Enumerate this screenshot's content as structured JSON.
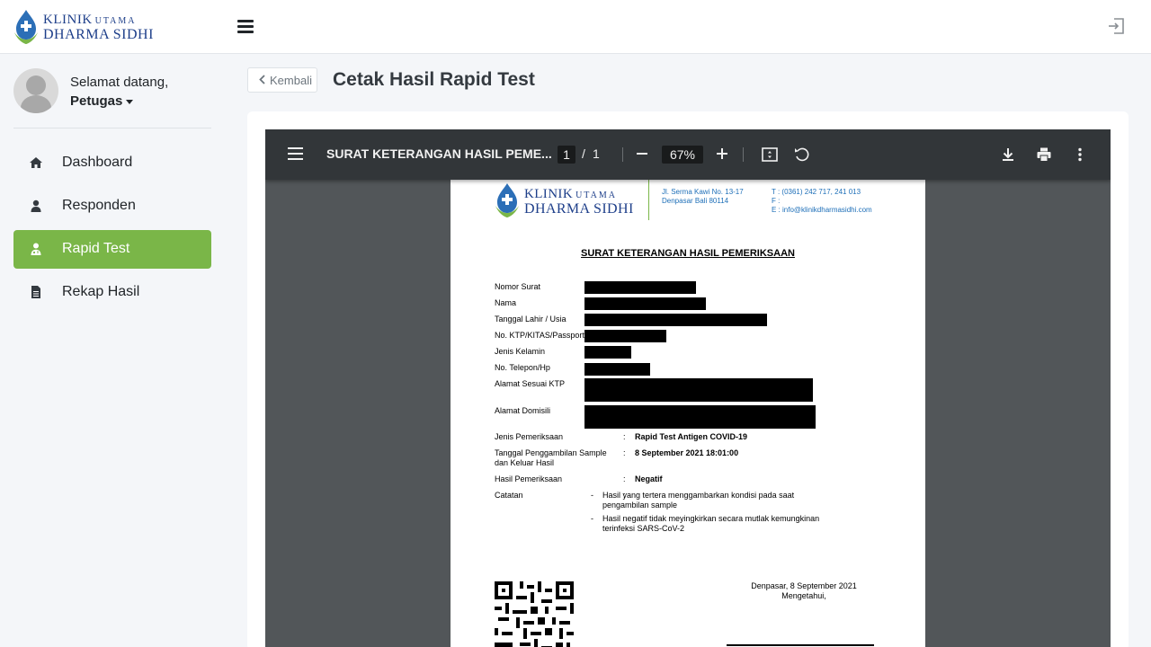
{
  "brand": {
    "line1": "KLINIK",
    "line1_small": "UTAMA",
    "line2": "DHARMA SIDHI"
  },
  "header": {
    "menu_icon": "hamburger-icon",
    "logout_icon": "sign-out-icon"
  },
  "user": {
    "greeting": "Selamat datang,",
    "name": "Petugas"
  },
  "sidebar": {
    "items": [
      {
        "label": "Dashboard",
        "icon": "home-icon",
        "active": false
      },
      {
        "label": "Responden",
        "icon": "user-icon",
        "active": false
      },
      {
        "label": "Rapid Test",
        "icon": "user-md-icon",
        "active": true
      },
      {
        "label": "Rekap Hasil",
        "icon": "file-text-icon",
        "active": false
      }
    ]
  },
  "main": {
    "back_label": "Kembali",
    "title": "Cetak Hasil Rapid Test"
  },
  "viewer": {
    "doc_title": "SURAT KETERANGAN HASIL PEME...",
    "page_current": "1",
    "page_separator": "/",
    "page_total": "1",
    "zoom": "67%"
  },
  "pdf": {
    "header": {
      "address_line1": "Jl. Serma Kawi No. 13-17",
      "address_line2": "Denpasar Bali 80114",
      "phone": "T : (0361) 242 717, 241 013",
      "fax": "F :",
      "email": "E : info@klinikdharmasidhi.com"
    },
    "heading": "SURAT KETERANGAN HASIL PEMERIKSAAN",
    "colon": ":",
    "fields": {
      "nomor_surat": "Nomor Surat",
      "nama": "Nama",
      "tanggal_lahir": "Tanggal Lahir / Usia",
      "ktp": "No. KTP/KITAS/Passport",
      "jenis_kelamin": "Jenis Kelamin",
      "telepon": "No. Telepon/Hp",
      "alamat_ktp": "Alamat Sesuai KTP",
      "alamat_domisili": "Alamat Domisili",
      "jenis_pemeriksaan": "Jenis Pemeriksaan",
      "tanggal_pengambilan": "Tanggal Penggambilan Sample dan Keluar Hasil",
      "hasil": "Hasil Pemeriksaan",
      "catatan": "Catatan"
    },
    "values": {
      "jenis_pemeriksaan": "Rapid Test Antigen COVID-19",
      "tanggal_pengambilan": "8 September 2021 18:01:00",
      "hasil": "Negatif"
    },
    "notes": [
      "Hasil yang tertera menggambarkan kondisi pada saat pengambilan sample",
      "Hasil negatif tidak meyingkirkan secara mutlak kemungkinan terinfeksi SARS-CoV-2"
    ],
    "note_dash": "-",
    "place_date": "Denpasar, 8 September 2021",
    "acknowledged": "Mengetahui,"
  }
}
